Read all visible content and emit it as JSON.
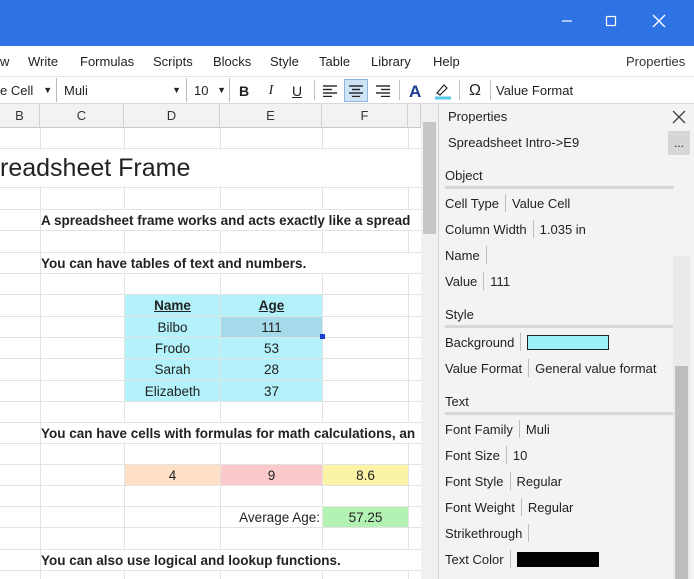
{
  "window": {
    "minimize": "–",
    "maximize": "☐",
    "close": "✕"
  },
  "menu": {
    "items": [
      "w",
      "Write",
      "Formulas",
      "Scripts",
      "Blocks",
      "Style",
      "Table",
      "Library",
      "Help"
    ],
    "properties": "Properties"
  },
  "toolbar": {
    "cell_type": "e Cell",
    "font_family": "Muli",
    "font_size": "10",
    "bold": "B",
    "italic": "I",
    "underline": "U",
    "omega": "Ω",
    "value_format": "Value Format"
  },
  "columns": [
    "B",
    "C",
    "D",
    "E",
    "F"
  ],
  "sheet": {
    "title": "readsheet Frame",
    "line1": "A spreadsheet frame works and acts exactly like a spread",
    "line2": "You can have tables of text and numbers.",
    "table": {
      "headers": [
        "Name",
        "Age"
      ],
      "rows": [
        [
          "Bilbo",
          "111"
        ],
        [
          "Frodo",
          "53"
        ],
        [
          "Sarah",
          "28"
        ],
        [
          "Elizabeth",
          "37"
        ]
      ]
    },
    "line3": "You can have cells with formulas for math calculations, an",
    "calc": {
      "v1": "4",
      "v2": "9",
      "v3": "8.6"
    },
    "avg_label": "Average Age:",
    "avg_value": "57.25",
    "line4": "You can also use logical and lookup functions."
  },
  "properties": {
    "header": "Properties",
    "path": "Spreadsheet Intro->E9",
    "more": "...",
    "sections": {
      "object": "Object",
      "style": "Style",
      "text": "Text"
    },
    "cell_type_label": "Cell Type",
    "cell_type_value": "Value Cell",
    "column_width_label": "Column Width",
    "column_width_value": "1.035 in",
    "name_label": "Name",
    "value_label": "Value",
    "value_value": "111",
    "background_label": "Background",
    "value_format_label": "Value Format",
    "value_format_value": "General value format",
    "font_family_label": "Font Family",
    "font_family_value": "Muli",
    "font_size_label": "Font Size",
    "font_size_value": "10",
    "font_style_label": "Font Style",
    "font_style_value": "Regular",
    "font_weight_label": "Font Weight",
    "font_weight_value": "Regular",
    "strikethrough_label": "Strikethrough",
    "text_color_label": "Text Color"
  },
  "colors": {
    "titlebar": "#2f72e4",
    "table_cyan": "#b3f1fb",
    "selected_cell": "#a6d9ea",
    "orange": "#fde0c6",
    "pink": "#fbc8cc",
    "yellow": "#fbf4a6",
    "green": "#b3f2b3",
    "background_swatch": "#9ef0f8",
    "text_color_swatch": "#000000"
  }
}
